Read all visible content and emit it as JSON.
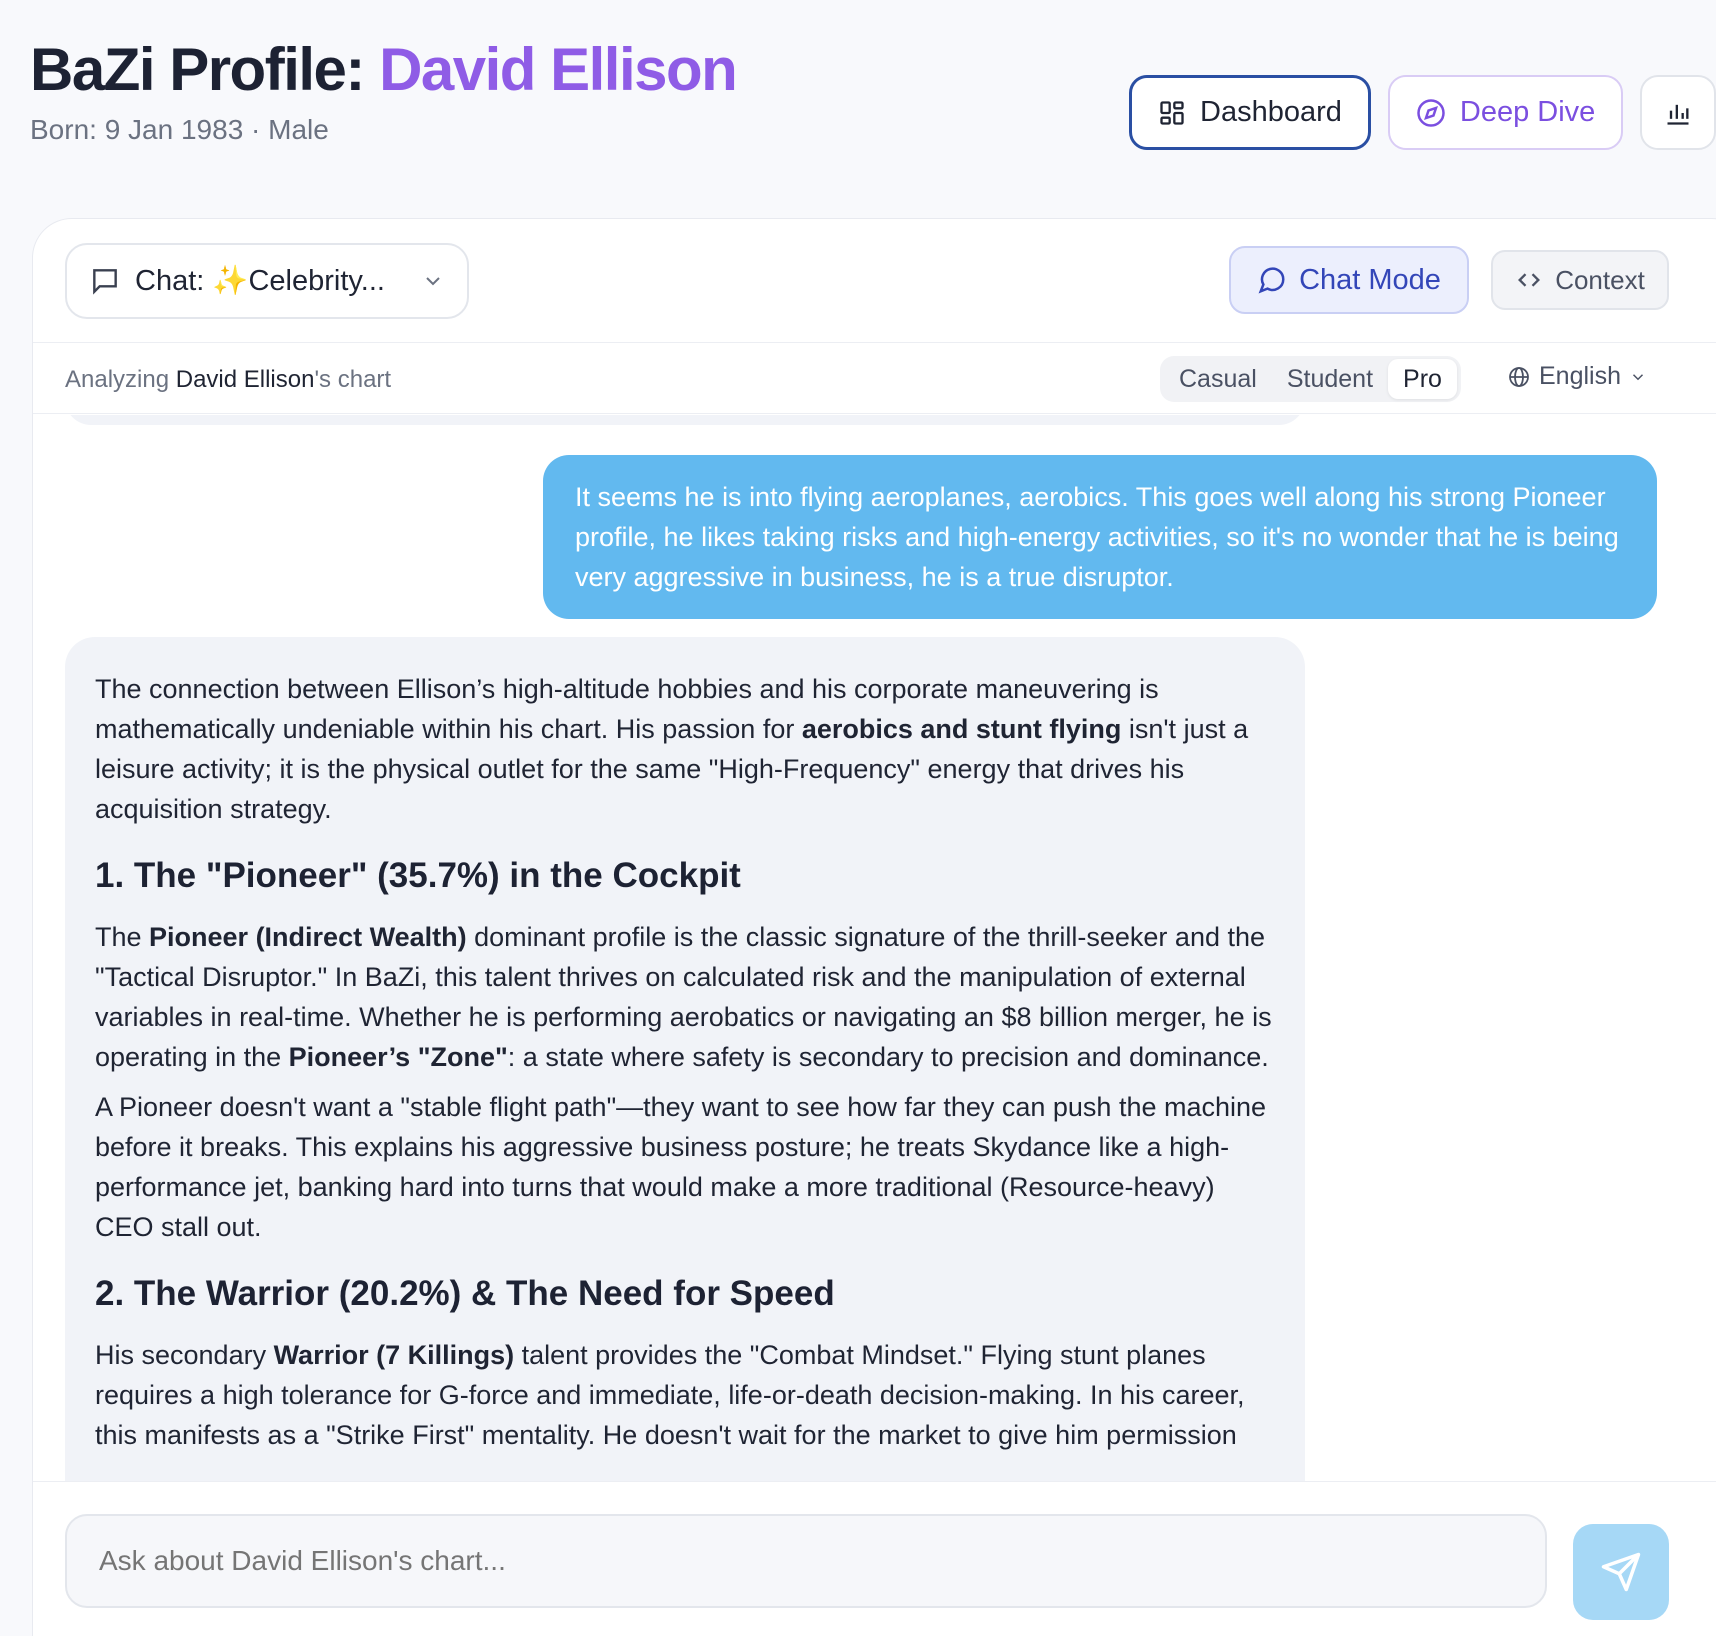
{
  "header": {
    "title_prefix": "BaZi Profile: ",
    "title_name": "David Ellison",
    "subtitle": "Born: 9 Jan 1983 · Male"
  },
  "nav": {
    "dashboard": "Dashboard",
    "deep_dive": "Deep Dive"
  },
  "chat": {
    "select_prefix": "Chat: ",
    "select_sparkle": "✨",
    "select_label": "Celebrity...",
    "mode": "Chat Mode",
    "context": "Context",
    "analyzing_prefix": "Analyzing ",
    "analyzing_name": "David Ellison",
    "analyzing_suffix": "'s chart",
    "levels": [
      "Casual",
      "Student",
      "Pro"
    ],
    "active_level": "Pro",
    "language": "English",
    "input_placeholder": "Ask about David Ellison's chart..."
  },
  "messages": {
    "user": "It seems he is into flying aeroplanes, aerobics. This goes well along his strong Pioneer profile, he likes taking risks and high-energy activities, so it's no wonder that he is being very aggressive in business, he is a true disruptor.",
    "ai": {
      "intro_a": "The connection between Ellison’s high-altitude hobbies and his corporate maneuvering is mathematically undeniable within his chart. His passion for ",
      "intro_bold": "aerobics and stunt flying",
      "intro_b": " isn't just a leisure activity; it is the physical outlet for the same \"High-Frequency\" energy that drives his acquisition strategy.",
      "h1": "1. The \"Pioneer\" (35.7%) in the Cockpit",
      "p1_a": "The ",
      "p1_bold1": "Pioneer (Indirect Wealth)",
      "p1_b": " dominant profile is the classic signature of the thrill-seeker and the \"Tactical Disruptor.\" In BaZi, this talent thrives on calculated risk and the manipulation of external variables in real-time. Whether he is performing aerobatics or navigating an $8 billion merger, he is operating in the ",
      "p1_bold2": "Pioneer’s \"Zone\"",
      "p1_c": ": a state where safety is secondary to precision and dominance.",
      "p2": "A Pioneer doesn't want a \"stable flight path\"—they want to see how far they can push the machine before it breaks. This explains his aggressive business posture; he treats Skydance like a high-performance jet, banking hard into turns that would make a more traditional (Resource-heavy) CEO stall out.",
      "h2": "2. The Warrior (20.2%) & The Need for Speed",
      "p3_a": "His secondary ",
      "p3_bold": "Warrior (7 Killings)",
      "p3_b": " talent provides the \"Combat Mindset.\" Flying stunt planes requires a high tolerance for G-force and immediate, life-or-death decision-making. In his career, this manifests as a \"Strike First\" mentality. He doesn't wait for the market to give him permission"
    }
  },
  "colors": {
    "accent_purple": "#8f5ce6",
    "user_bubble": "#62b9ef",
    "send_button": "#a6d8f6",
    "mode_blue": "#3346b8"
  },
  "icons": {
    "dashboard": "grid-icon",
    "deep_dive": "compass-icon",
    "stats": "bar-chart-icon",
    "chat_select": "message-square-icon",
    "chat_mode": "message-circle-icon",
    "context": "code-icon",
    "language": "globe-icon",
    "send": "send-icon"
  }
}
